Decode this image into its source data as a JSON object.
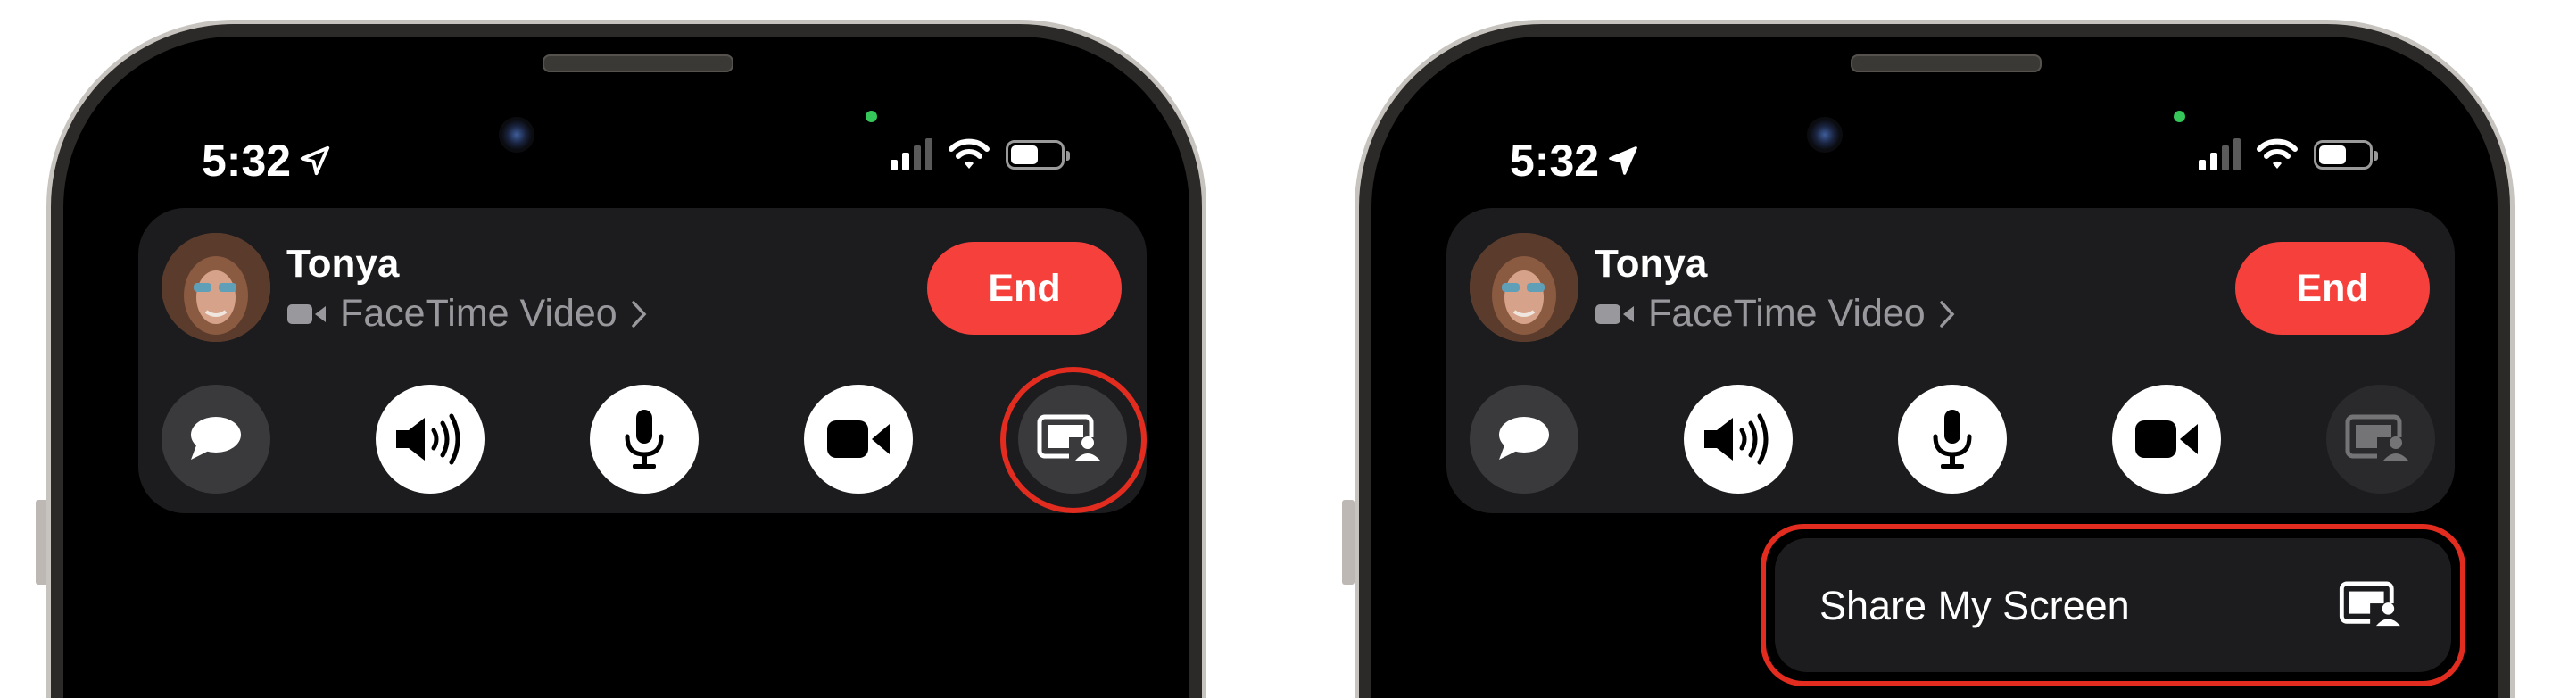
{
  "left_screen": {
    "status_bar": {
      "time": "5:32"
    },
    "call": {
      "caller_name": "Tonya",
      "call_type": "FaceTime Video",
      "end_label": "End"
    },
    "highlight": "share-screen-button"
  },
  "right_screen": {
    "status_bar": {
      "time": "5:32"
    },
    "call": {
      "caller_name": "Tonya",
      "call_type": "FaceTime Video",
      "end_label": "End"
    },
    "share_menu": {
      "label": "Share My Screen"
    },
    "highlight": "share-my-screen-menu-item"
  },
  "controls": [
    "message-icon",
    "speaker-icon",
    "microphone-icon",
    "video-camera-icon",
    "share-screen-icon"
  ],
  "colors": {
    "end_button": "#f6403b",
    "highlight_ring": "#e12c1f",
    "panel": "#1c1c1e",
    "secondary_text": "#98989d",
    "camera_indicator": "#35c759"
  }
}
